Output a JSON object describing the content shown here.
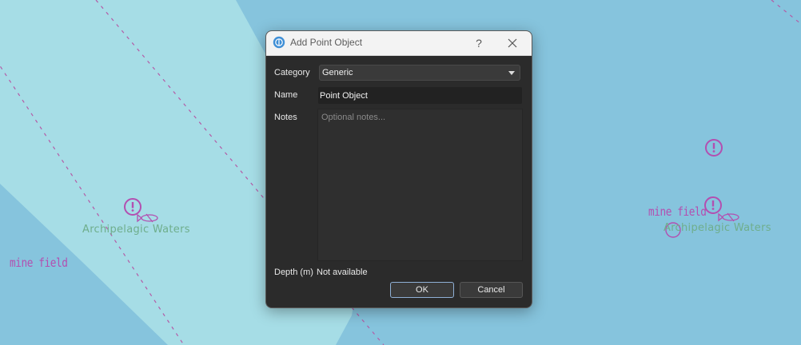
{
  "map": {
    "labels": {
      "archipelagic_left": "Archipelagic Waters",
      "archipelagic_right": "Archipelagic Waters",
      "mine_field_left": "mine field",
      "mine_field_right": "mine field"
    },
    "colors": {
      "deep_water": "#86c4dd",
      "shallow_water": "#a6dde6",
      "boundary_line": "#b45ba6",
      "symbol": "#b34fb0"
    }
  },
  "dialog": {
    "title": "Add Point Object",
    "help_label": "?",
    "category": {
      "label": "Category",
      "value": "Generic"
    },
    "name": {
      "label": "Name",
      "value": "Point Object"
    },
    "notes": {
      "label": "Notes",
      "placeholder": "Optional notes..."
    },
    "depth": {
      "label": "Depth (m)",
      "value": "Not available"
    },
    "buttons": {
      "ok": "OK",
      "cancel": "Cancel"
    }
  }
}
